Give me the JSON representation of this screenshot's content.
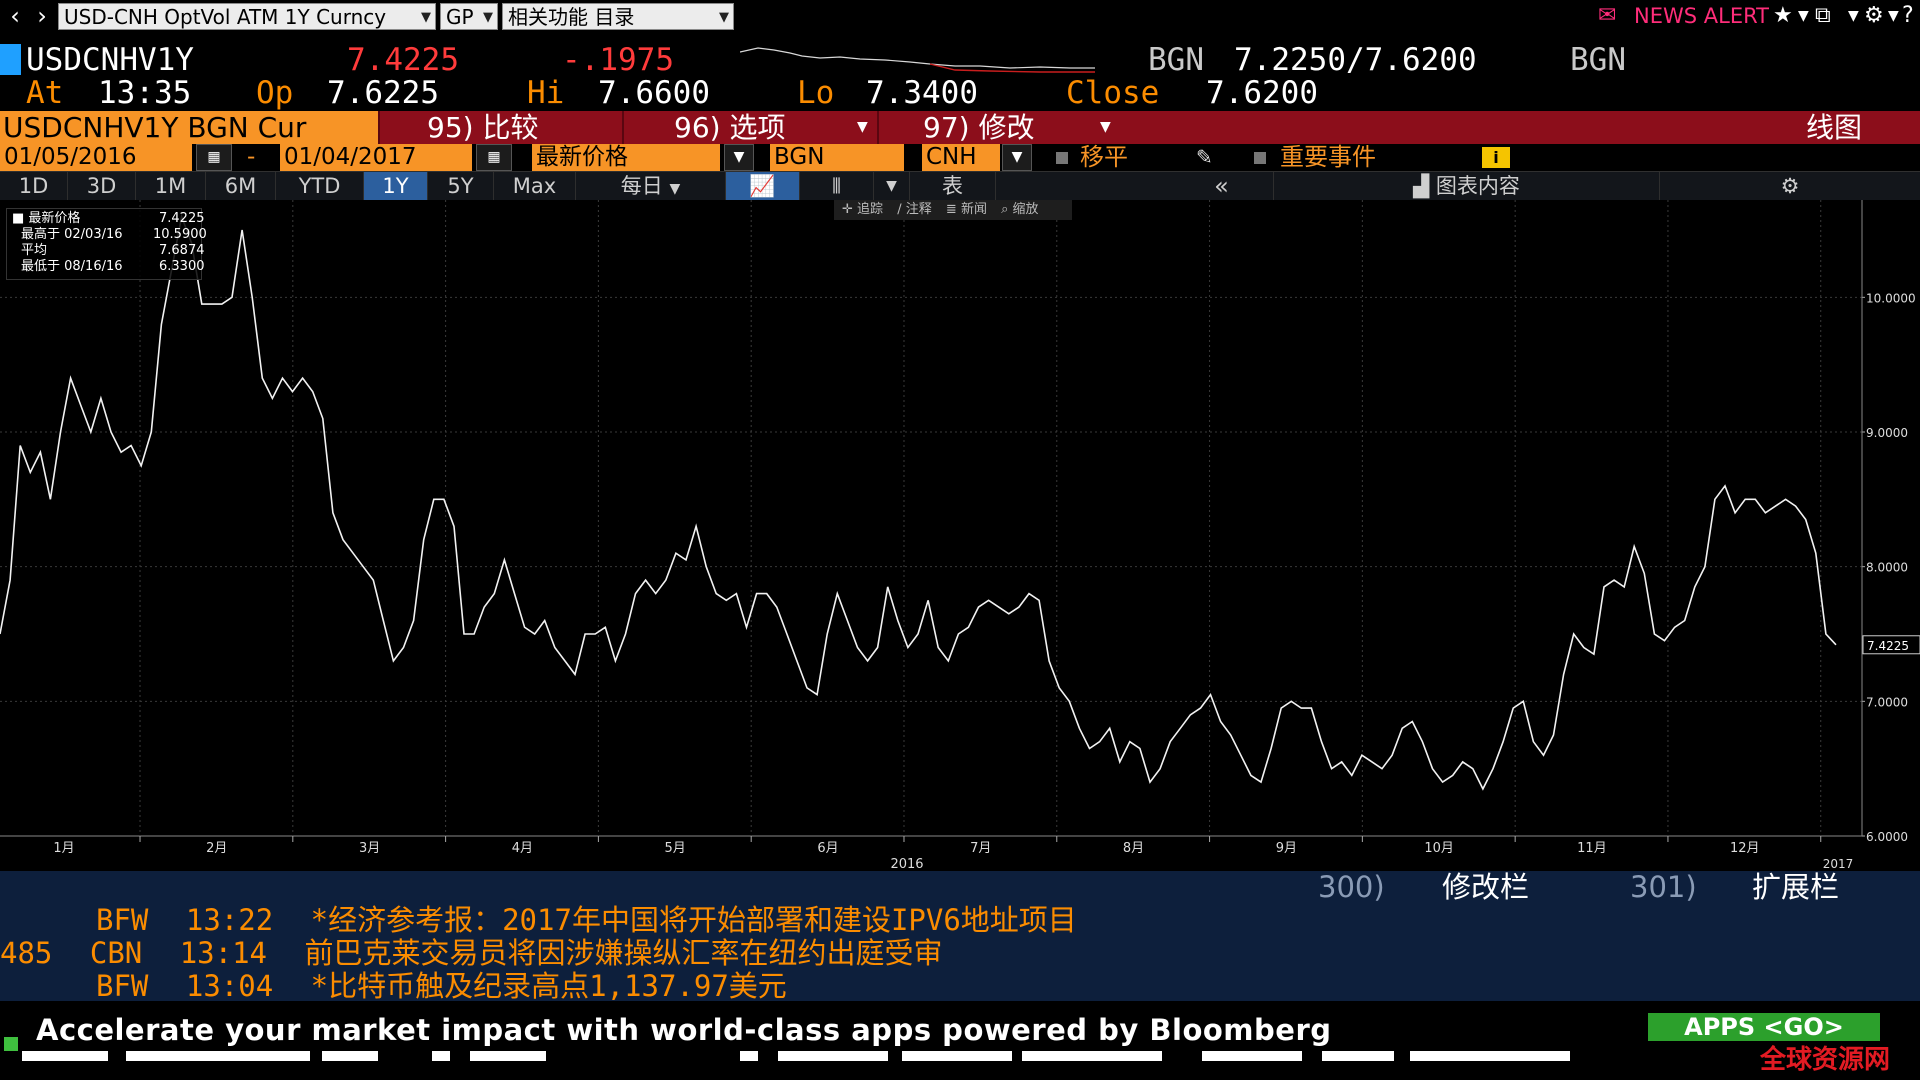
{
  "topbar": {
    "back_icon": "chevron-left-icon",
    "forward_icon": "chevron-right-icon",
    "security_field": "USD-CNH OptVol ATM 1Y Curncy",
    "function_field": "GP",
    "related_field": "相关功能  目录",
    "news_alert": "NEWS ALERT",
    "colors": {
      "news_alert": "#ff2d7a"
    }
  },
  "quote": {
    "ticker": "USDCNHV1Y",
    "last": "7.4225",
    "change": "-.1975",
    "bgn_label": "BGN",
    "bid_ask": "7.2250/7.6200",
    "bgn_label_right": "BGN",
    "at_label": "At",
    "time": "13:35",
    "op_label": "Op",
    "open": "7.6225",
    "hi_label": "Hi",
    "high": "7.6600",
    "lo_label": "Lo",
    "low": "7.3400",
    "close_label": "Close",
    "close": "7.6200"
  },
  "funcbar": {
    "security": "USDCNHV1Y BGN Cur",
    "compare": "95) 比较",
    "options": "96) 选项",
    "edit": "97) 修改",
    "chart_type": "线图"
  },
  "daterow": {
    "start_date": "01/05/2016",
    "dash": "-",
    "end_date": "01/04/2017",
    "field": "最新价格",
    "source": "BGN",
    "currency": "CNH",
    "moving_avg": "移平",
    "events": "重要事件"
  },
  "rangerow": {
    "tabs": [
      "1D",
      "3D",
      "1M",
      "6M",
      "YTD",
      "1Y",
      "5Y",
      "Max"
    ],
    "active_tab": "1Y",
    "frequency": "每日",
    "table": "表",
    "chart_content": "图表内容"
  },
  "chart_toolbar": {
    "track": "追踪",
    "annotate": "注释",
    "news": "新闻",
    "zoom": "缩放"
  },
  "legend": {
    "last_label": "最新价格",
    "last_value": "7.4225",
    "high_label": "最高于 02/03/16",
    "high_value": "10.5900",
    "avg_label": "平均",
    "avg_value": "7.6874",
    "low_label": "最低于 08/16/16",
    "low_value": "6.3300"
  },
  "chart_data": {
    "type": "line",
    "ylim": [
      6.0,
      10.5
    ],
    "y_ticks": [
      "6.0000",
      "7.0000",
      "8.0000",
      "9.0000",
      "10.0000"
    ],
    "x_ticks": [
      "1月",
      "2月",
      "3月",
      "4月",
      "5月",
      "6月",
      "7月",
      "8月",
      "9月",
      "10月",
      "11月",
      "12月"
    ],
    "year_label": "2016",
    "year_label_end": "2017",
    "last_value_label": "7.4225",
    "series": [
      {
        "values": [
          7.5,
          7.9,
          8.9,
          8.7,
          8.85,
          8.5,
          9.0,
          9.4,
          9.2,
          9.0,
          9.25,
          9.0,
          8.85,
          8.9,
          8.75,
          9.0,
          9.8,
          10.2,
          10.6,
          10.4,
          9.95,
          9.95,
          9.95,
          10.0,
          10.5,
          10.0,
          9.4,
          9.25,
          9.4,
          9.3,
          9.4,
          9.3,
          9.1,
          8.4,
          8.2,
          8.1,
          8.0,
          7.9,
          7.6,
          7.3,
          7.4,
          7.6,
          8.2,
          8.5,
          8.5,
          8.3,
          7.5,
          7.5,
          7.7,
          7.8,
          8.05,
          7.8,
          7.55,
          7.5,
          7.6,
          7.4,
          7.3,
          7.2,
          7.5,
          7.5,
          7.55,
          7.3,
          7.5,
          7.8,
          7.9,
          7.8,
          7.9,
          8.1,
          8.05,
          8.3,
          8.0,
          7.8,
          7.75,
          7.8,
          7.55,
          7.8,
          7.8,
          7.7,
          7.5,
          7.3,
          7.1,
          7.05,
          7.5,
          7.8,
          7.6,
          7.4,
          7.3,
          7.4,
          7.85,
          7.6,
          7.4,
          7.5,
          7.75,
          7.4,
          7.3,
          7.5,
          7.55,
          7.7,
          7.75,
          7.7,
          7.65,
          7.7,
          7.8,
          7.75,
          7.3,
          7.1,
          7.0,
          6.8,
          6.65,
          6.7,
          6.8,
          6.55,
          6.7,
          6.65,
          6.4,
          6.5,
          6.7,
          6.8,
          6.9,
          6.95,
          7.05,
          6.85,
          6.75,
          6.6,
          6.45,
          6.4,
          6.65,
          6.95,
          7.0,
          6.95,
          6.95,
          6.7,
          6.5,
          6.55,
          6.45,
          6.6,
          6.55,
          6.5,
          6.6,
          6.8,
          6.85,
          6.7,
          6.5,
          6.4,
          6.45,
          6.55,
          6.5,
          6.35,
          6.5,
          6.7,
          6.95,
          7.0,
          6.7,
          6.6,
          6.75,
          7.2,
          7.5,
          7.4,
          7.35,
          7.85,
          7.9,
          7.85,
          8.15,
          7.95,
          7.5,
          7.45,
          7.55,
          7.6,
          7.85,
          8.0,
          8.5,
          8.6,
          8.4,
          8.5,
          8.5,
          8.4,
          8.45,
          8.5,
          8.45,
          8.35,
          8.1,
          7.5,
          7.42
        ]
      }
    ]
  }
}
